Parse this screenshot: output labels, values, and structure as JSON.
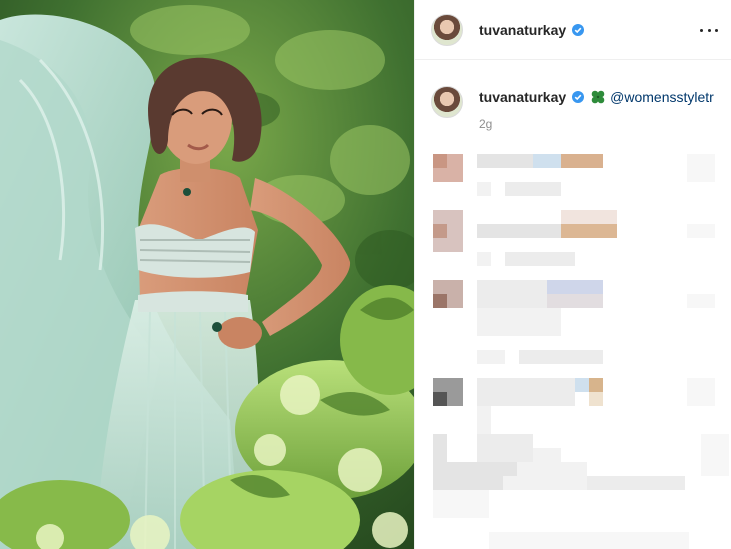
{
  "post": {
    "username": "tuvanaturkay",
    "verified": true,
    "caption_mention": "@womensstyletr",
    "time_ago": "2g"
  },
  "icons": {
    "more": "more-options-icon",
    "verified": "verified-badge-icon",
    "clover": "four-leaf-clover-emoji"
  },
  "colors": {
    "text": "#262626",
    "secondary": "#8e8e8e",
    "link": "#00376b",
    "verified": "#3897f0",
    "border": "#efefef"
  }
}
